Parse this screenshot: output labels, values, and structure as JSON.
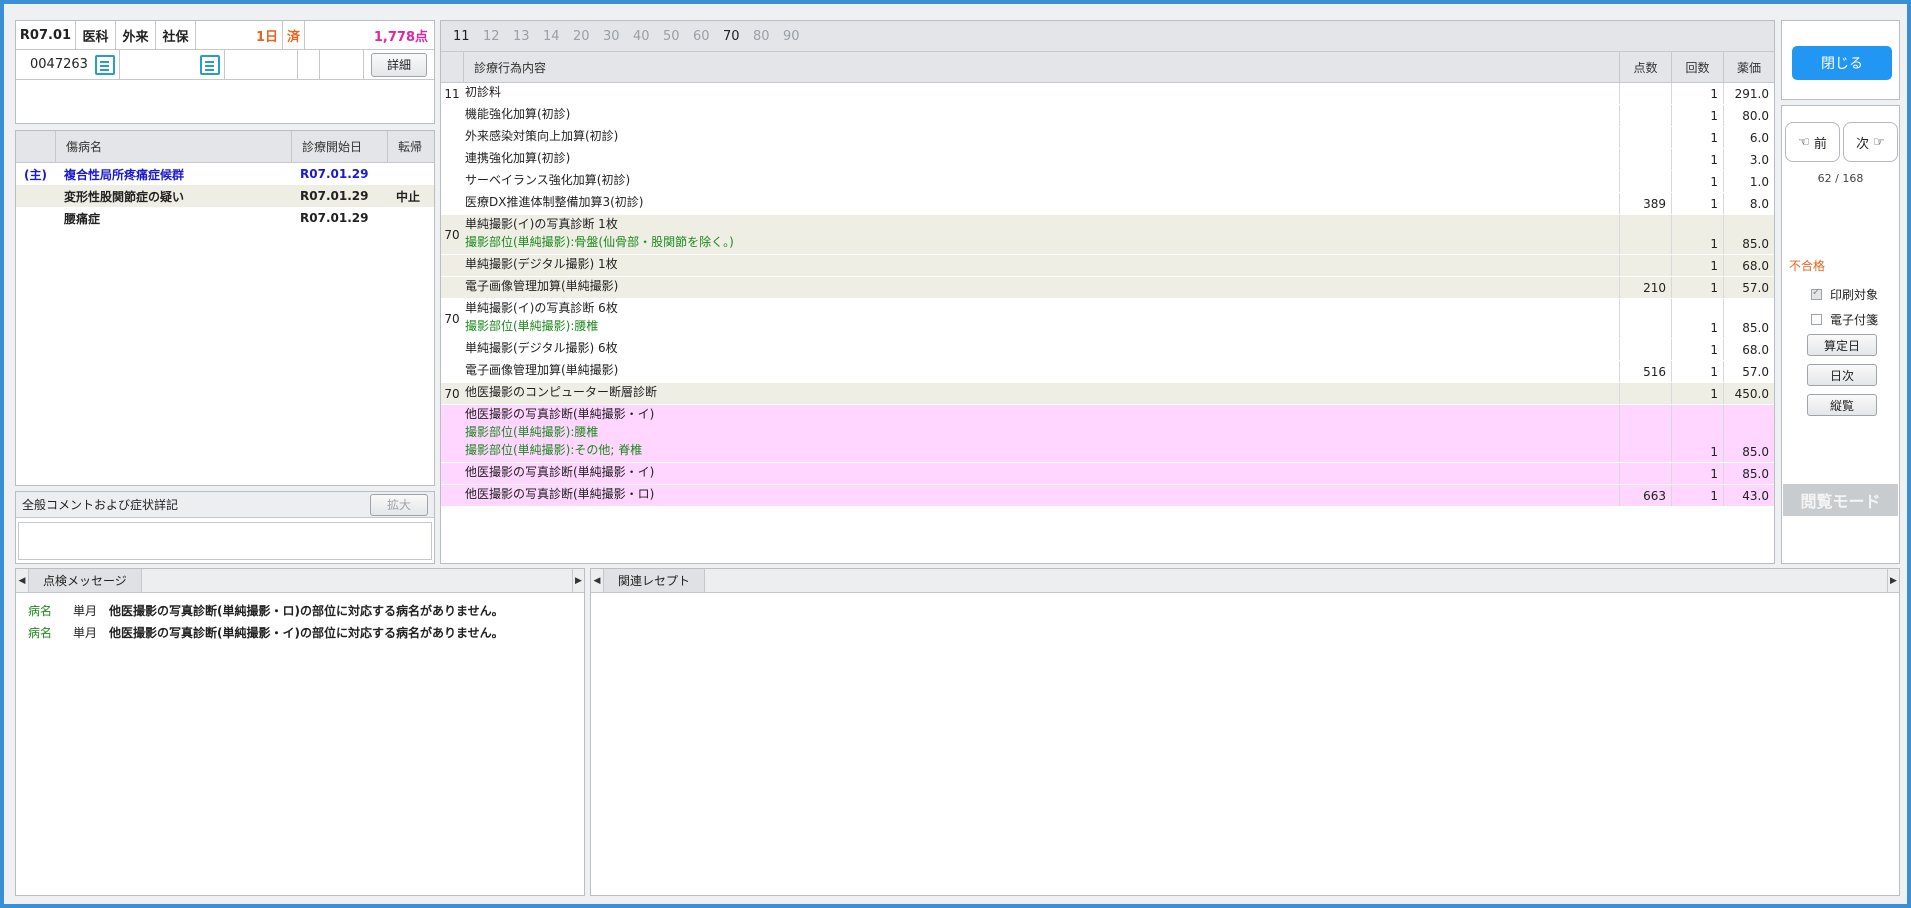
{
  "header": {
    "period": "R07.01",
    "category": "医科",
    "visit_type": "外来",
    "insurance": "社保",
    "days": "1日",
    "status": "済",
    "points": "1,778点",
    "patient_id": "0047263",
    "detail_label": "詳細"
  },
  "diseases": {
    "columns": [
      "傷病名",
      "診療開始日",
      "転帰"
    ],
    "rows": [
      {
        "tag": "(主)",
        "name": "複合性局所疼痛症候群",
        "date": "R07.01.29",
        "outcome": ""
      },
      {
        "tag": "",
        "name": "変形性股関節症の疑い",
        "date": "R07.01.29",
        "outcome": "中止"
      },
      {
        "tag": "",
        "name": "腰痛症",
        "date": "R07.01.29",
        "outcome": ""
      }
    ]
  },
  "comments": {
    "title": "全般コメントおよび症状詳記",
    "expand_label": "拡大"
  },
  "main": {
    "tabs": [
      "11",
      "12",
      "13",
      "14",
      "20",
      "30",
      "40",
      "50",
      "60",
      "70",
      "80",
      "90"
    ],
    "columns": [
      "診療行為内容",
      "点数",
      "回数",
      "薬価"
    ],
    "rows": [
      {
        "code": "11",
        "lines": [
          {
            "text": "初診料",
            "green": false
          }
        ],
        "pts": "",
        "cnt": "1",
        "drug": "291.0",
        "bg": "white"
      },
      {
        "code": "",
        "lines": [
          {
            "text": "機能強化加算(初診)",
            "green": false
          }
        ],
        "pts": "",
        "cnt": "1",
        "drug": "80.0",
        "bg": "white"
      },
      {
        "code": "",
        "lines": [
          {
            "text": "外来感染対策向上加算(初診)",
            "green": false
          }
        ],
        "pts": "",
        "cnt": "1",
        "drug": "6.0",
        "bg": "white"
      },
      {
        "code": "",
        "lines": [
          {
            "text": "連携強化加算(初診)",
            "green": false
          }
        ],
        "pts": "",
        "cnt": "1",
        "drug": "3.0",
        "bg": "white"
      },
      {
        "code": "",
        "lines": [
          {
            "text": "サーベイランス強化加算(初診)",
            "green": false
          }
        ],
        "pts": "",
        "cnt": "1",
        "drug": "1.0",
        "bg": "white"
      },
      {
        "code": "",
        "lines": [
          {
            "text": "医療DX推進体制整備加算3(初診)",
            "green": false
          }
        ],
        "pts": "389",
        "cnt": "1",
        "drug": "8.0",
        "bg": "white"
      },
      {
        "code": "70",
        "lines": [
          {
            "text": "単純撮影(イ)の写真診断 1枚",
            "green": false
          },
          {
            "text": "撮影部位(単純撮影):骨盤(仙骨部・股関節を除く。)",
            "green": true
          }
        ],
        "pts": "",
        "cnt": "1",
        "drug": "85.0",
        "bg": "beige"
      },
      {
        "code": "",
        "lines": [
          {
            "text": "単純撮影(デジタル撮影) 1枚",
            "green": false
          }
        ],
        "pts": "",
        "cnt": "1",
        "drug": "68.0",
        "bg": "beige"
      },
      {
        "code": "",
        "lines": [
          {
            "text": "電子画像管理加算(単純撮影)",
            "green": false
          }
        ],
        "pts": "210",
        "cnt": "1",
        "drug": "57.0",
        "bg": "beige"
      },
      {
        "code": "70",
        "lines": [
          {
            "text": "単純撮影(イ)の写真診断 6枚",
            "green": false
          },
          {
            "text": "撮影部位(単純撮影):腰椎",
            "green": true
          }
        ],
        "pts": "",
        "cnt": "1",
        "drug": "85.0",
        "bg": "white"
      },
      {
        "code": "",
        "lines": [
          {
            "text": "単純撮影(デジタル撮影) 6枚",
            "green": false
          }
        ],
        "pts": "",
        "cnt": "1",
        "drug": "68.0",
        "bg": "white"
      },
      {
        "code": "",
        "lines": [
          {
            "text": "電子画像管理加算(単純撮影)",
            "green": false
          }
        ],
        "pts": "516",
        "cnt": "1",
        "drug": "57.0",
        "bg": "white"
      },
      {
        "code": "70",
        "lines": [
          {
            "text": "他医撮影のコンピューター断層診断",
            "green": false
          }
        ],
        "pts": "",
        "cnt": "1",
        "drug": "450.0",
        "bg": "beige"
      },
      {
        "code": "",
        "lines": [
          {
            "text": "他医撮影の写真診断(単純撮影・イ)",
            "green": false
          },
          {
            "text": "撮影部位(単純撮影):腰椎",
            "green": true
          },
          {
            "text": "撮影部位(単純撮影):その他; 脊椎",
            "green": true
          }
        ],
        "pts": "",
        "cnt": "1",
        "drug": "85.0",
        "bg": "pink"
      },
      {
        "code": "",
        "lines": [
          {
            "text": "他医撮影の写真診断(単純撮影・イ)",
            "green": false
          }
        ],
        "pts": "",
        "cnt": "1",
        "drug": "85.0",
        "bg": "pink"
      },
      {
        "code": "",
        "lines": [
          {
            "text": "他医撮影の写真診断(単純撮影・ロ)",
            "green": false
          }
        ],
        "pts": "663",
        "cnt": "1",
        "drug": "43.0",
        "bg": "pink"
      }
    ]
  },
  "side": {
    "close_label": "閉じる",
    "prev_label": "前",
    "next_label": "次",
    "counter": "62 / 168",
    "result": "不合格",
    "print_label": "印刷対象",
    "print_checked": true,
    "attach_label": "電子付箋",
    "attach_checked": false,
    "calc_day_label": "算定日",
    "daily_label": "日次",
    "vertical_label": "縦覧",
    "mode_label": "閲覧モード"
  },
  "check_messages": {
    "tab_label": "点検メッセージ",
    "items": [
      {
        "kind": "病名",
        "term": "単月",
        "text": "他医撮影の写真診断(単純撮影・ロ)の部位に対応する病名がありません。"
      },
      {
        "kind": "病名",
        "term": "単月",
        "text": "他医撮影の写真診断(単純撮影・イ)の部位に対応する病名がありません。"
      }
    ]
  },
  "related": {
    "tab_label": "関連レセプト"
  },
  "colors": {
    "accent": "#2196f3",
    "frame": "#3a8fd6",
    "orange": "#e8641e",
    "magenta": "#e0269c",
    "blue_text": "#1a1ad0",
    "green_text": "#1e8a1e",
    "pink_row": "#ffd6ff",
    "beige_row": "#eeeee4"
  }
}
